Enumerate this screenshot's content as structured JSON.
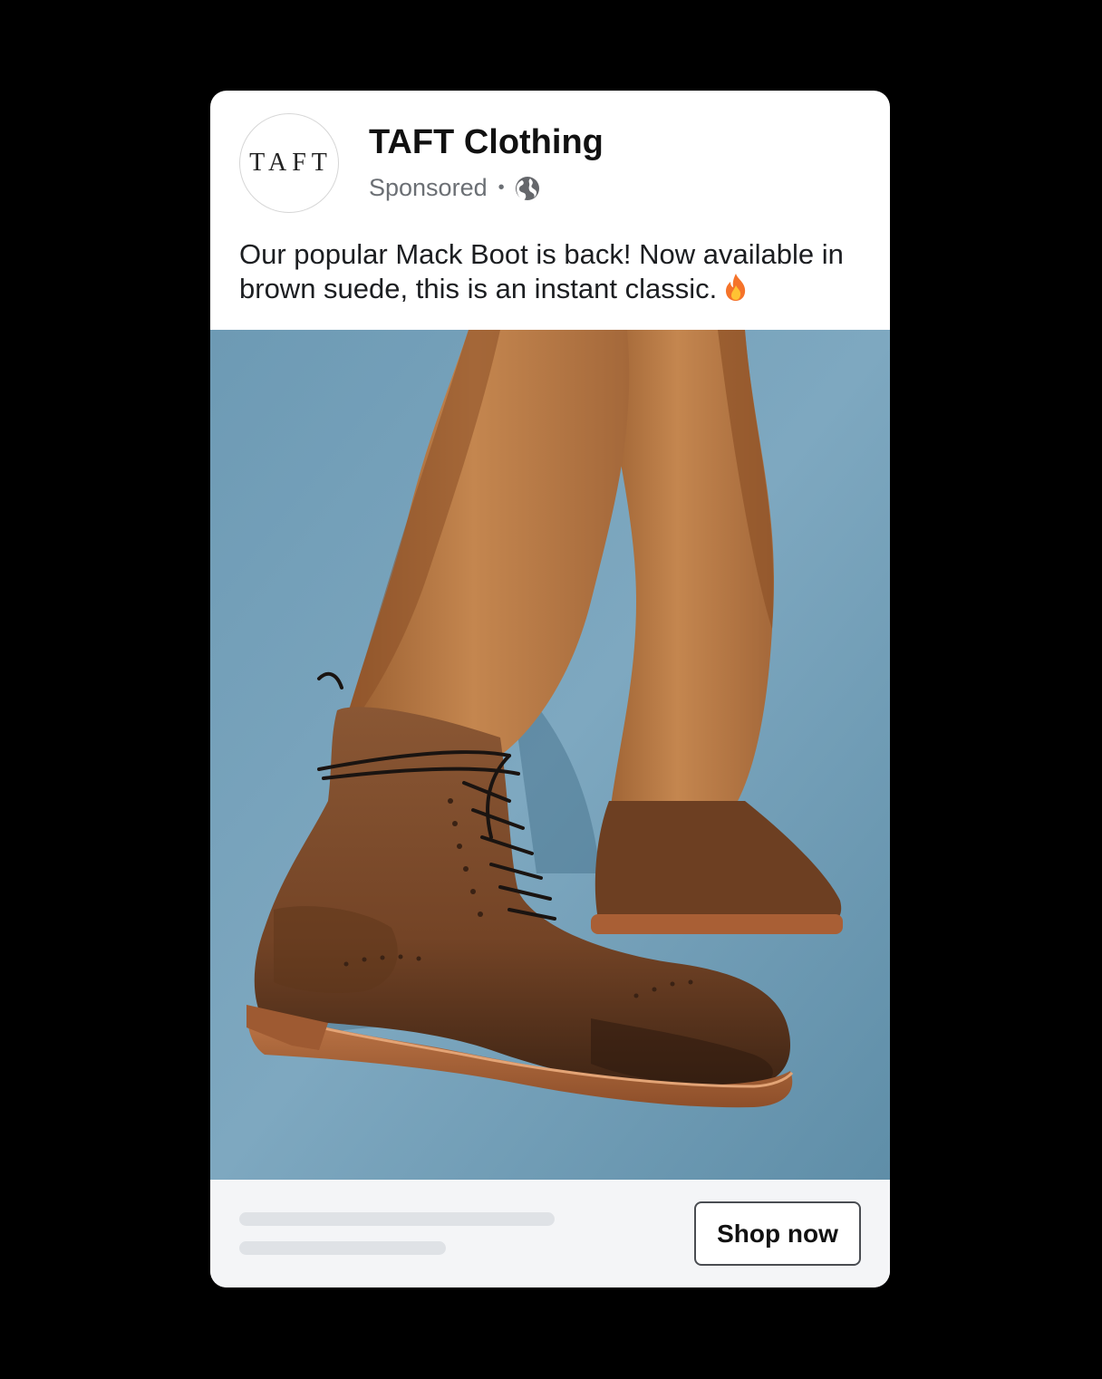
{
  "post": {
    "page_name": "TAFT Clothing",
    "avatar_text": "TAFT",
    "sponsored_label": "Sponsored",
    "separator": "•",
    "audience_icon": "globe-icon",
    "caption": "Our popular Mack Boot is back! Now available in brown suede, this is an instant classic.",
    "caption_emoji_icon": "fire-icon"
  },
  "footer": {
    "cta_label": "Shop now"
  },
  "colors": {
    "backdrop": "#000000",
    "card": "#ffffff",
    "photo_background": "#6e9bb5",
    "trousers": "#b87a46",
    "boot": "#7a4a2c",
    "sole": "#b06a3e",
    "footer_background": "#f4f5f7"
  }
}
